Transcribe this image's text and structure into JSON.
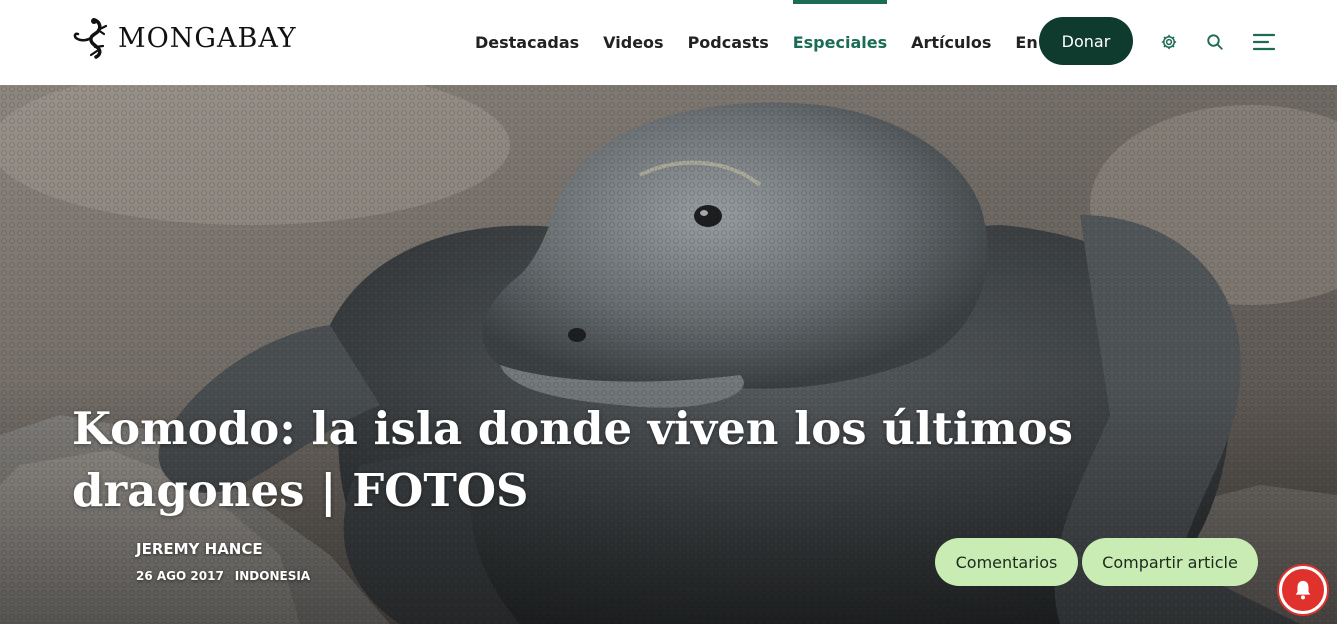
{
  "header": {
    "brand": "MONGABAY",
    "nav": [
      {
        "label": "Destacadas",
        "active": false
      },
      {
        "label": "Videos",
        "active": false
      },
      {
        "label": "Podcasts",
        "active": false
      },
      {
        "label": "Especiales",
        "active": true
      },
      {
        "label": "Artículos",
        "active": false
      },
      {
        "label": "En corto",
        "active": false
      }
    ],
    "donate_label": "Donar",
    "icons": [
      "settings-icon",
      "search-icon",
      "menu-icon"
    ]
  },
  "article": {
    "title": "Komodo: la isla donde viven los últimos dragones | FOTOS",
    "author": "JEREMY HANCE",
    "date": "26 AGO 2017",
    "location": "INDONESIA",
    "comments_label": "Comentarios",
    "share_label": "Compartir article"
  },
  "notification": {
    "icon": "bell-icon"
  },
  "colors": {
    "accent": "#1b6b55",
    "donate_bg": "#0f3a2e",
    "pill_bg": "#c9ecb4",
    "notification": "#e0312c"
  }
}
